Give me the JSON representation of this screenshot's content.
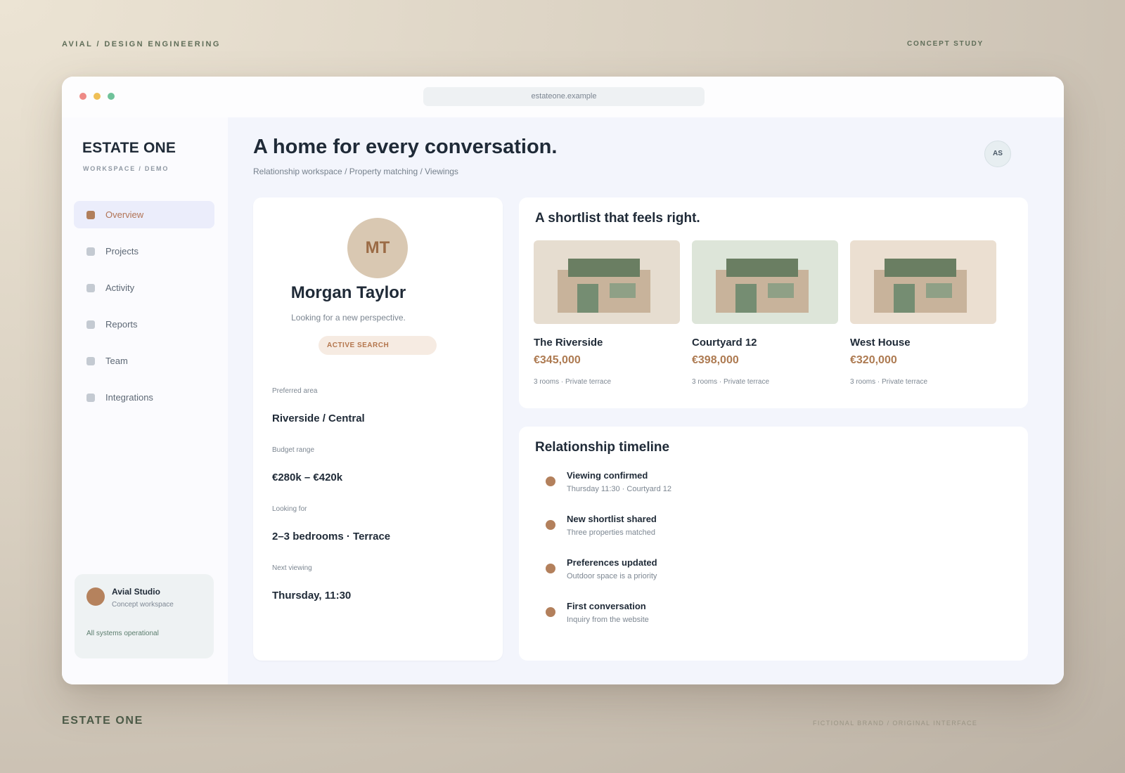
{
  "page": {
    "top_left": "AVIAL   /   DESIGN ENGINEERING",
    "top_right": "CONCEPT STUDY",
    "bottom_brand": "ESTATE ONE",
    "bottom_note": "FICTIONAL BRAND / ORIGINAL INTERFACE"
  },
  "browser": {
    "url": "estateone.example"
  },
  "sidebar": {
    "brand": "ESTATE ONE",
    "brand_sub": "WORKSPACE / DEMO",
    "items": [
      {
        "label": "Overview",
        "active": true
      },
      {
        "label": "Projects",
        "active": false
      },
      {
        "label": "Activity",
        "active": false
      },
      {
        "label": "Reports",
        "active": false
      },
      {
        "label": "Team",
        "active": false
      },
      {
        "label": "Integrations",
        "active": false
      }
    ],
    "studio": {
      "name": "Avial Studio",
      "sub": "Concept workspace",
      "status": "All systems operational"
    }
  },
  "header": {
    "title": "A home for every conversation.",
    "breadcrumb": "Relationship workspace / Property matching / Viewings",
    "avatar": "AS"
  },
  "profile": {
    "initials": "MT",
    "name": "Morgan Taylor",
    "tagline": "Looking for a new perspective.",
    "badge": "ACTIVE SEARCH",
    "fields": [
      {
        "label": "Preferred area",
        "value": "Riverside / Central"
      },
      {
        "label": "Budget range",
        "value": "€280k – €420k"
      },
      {
        "label": "Looking for",
        "value": "2–3 bedrooms · Terrace"
      },
      {
        "label": "Next viewing",
        "value": "Thursday, 11:30"
      }
    ]
  },
  "shortlist": {
    "title": "A shortlist that feels right.",
    "properties": [
      {
        "name": "The Riverside",
        "price": "€345,000",
        "details": "3 rooms · Private terrace",
        "bg": "#e6ddd0"
      },
      {
        "name": "Courtyard 12",
        "price": "€398,000",
        "details": "3 rooms · Private terrace",
        "bg": "#dde5d9"
      },
      {
        "name": "West House",
        "price": "€320,000",
        "details": "3 rooms · Private terrace",
        "bg": "#ebdfd1"
      }
    ]
  },
  "timeline": {
    "title": "Relationship timeline",
    "events": [
      {
        "title": "Viewing confirmed",
        "sub": "Thursday 11:30 · Courtyard 12"
      },
      {
        "title": "New shortlist shared",
        "sub": "Three properties matched"
      },
      {
        "title": "Preferences updated",
        "sub": "Outdoor space is a priority"
      },
      {
        "title": "First conversation",
        "sub": "Inquiry from the website"
      }
    ]
  },
  "colors": {
    "accent": "#b17f5b",
    "roof": "#6a7e62",
    "nav_active_bg": "#ebedfb"
  }
}
